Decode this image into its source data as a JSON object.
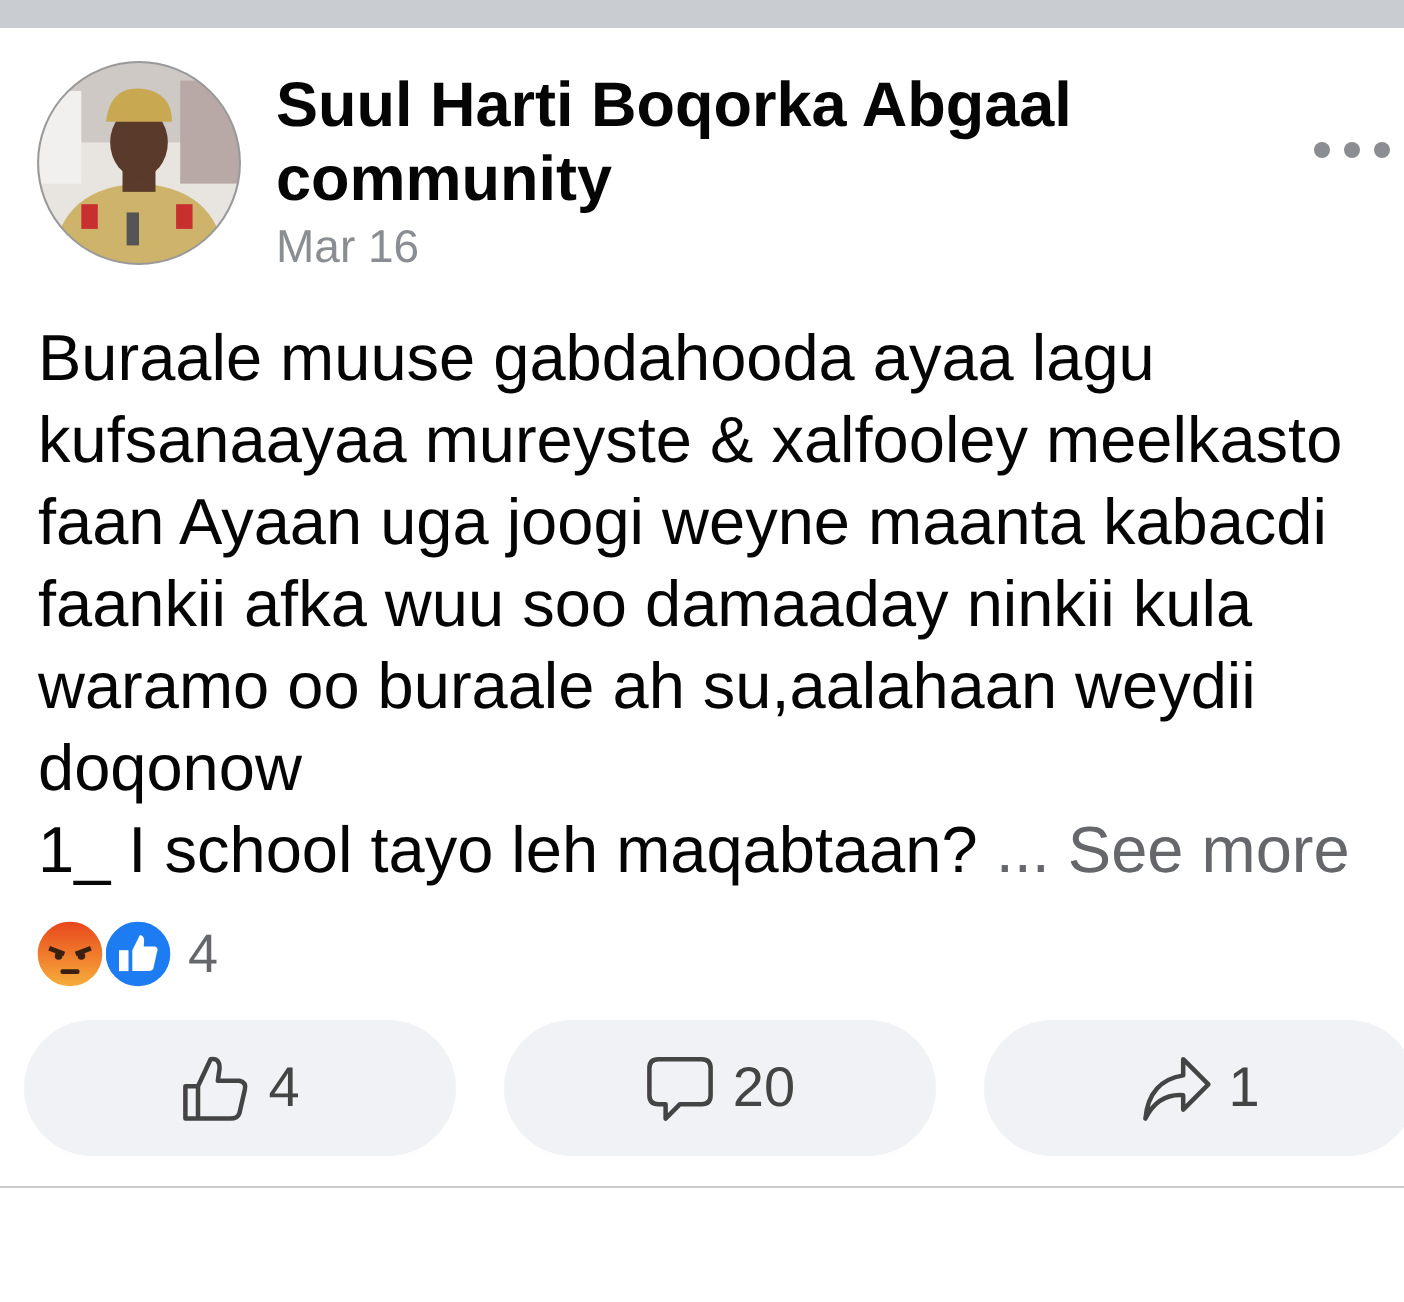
{
  "post": {
    "author": "Suul Harti Boqorka Abgaal community",
    "date": "Mar 16",
    "body_lines": [
      "Buraale muuse gabdahooda ayaa lagu",
      "kufsanaayaa mureyste & xalfooley meelkasto",
      "faan Ayaan uga joogi weyne maanta kabacdi",
      "faankii afka wuu soo damaaday ninkii kula",
      "waramo oo buraale ah su,aalahaan weydii",
      "doqonow"
    ],
    "last_line": "1_ I school tayo leh maqabtaan?",
    "see_more": "... See more",
    "reactions": {
      "icons": [
        {
          "kind": "angry"
        },
        {
          "kind": "like"
        }
      ],
      "count": "4"
    },
    "actions": [
      {
        "kind": "like",
        "count": "4"
      },
      {
        "kind": "comment",
        "count": "20"
      },
      {
        "kind": "share",
        "count": "1"
      }
    ]
  }
}
